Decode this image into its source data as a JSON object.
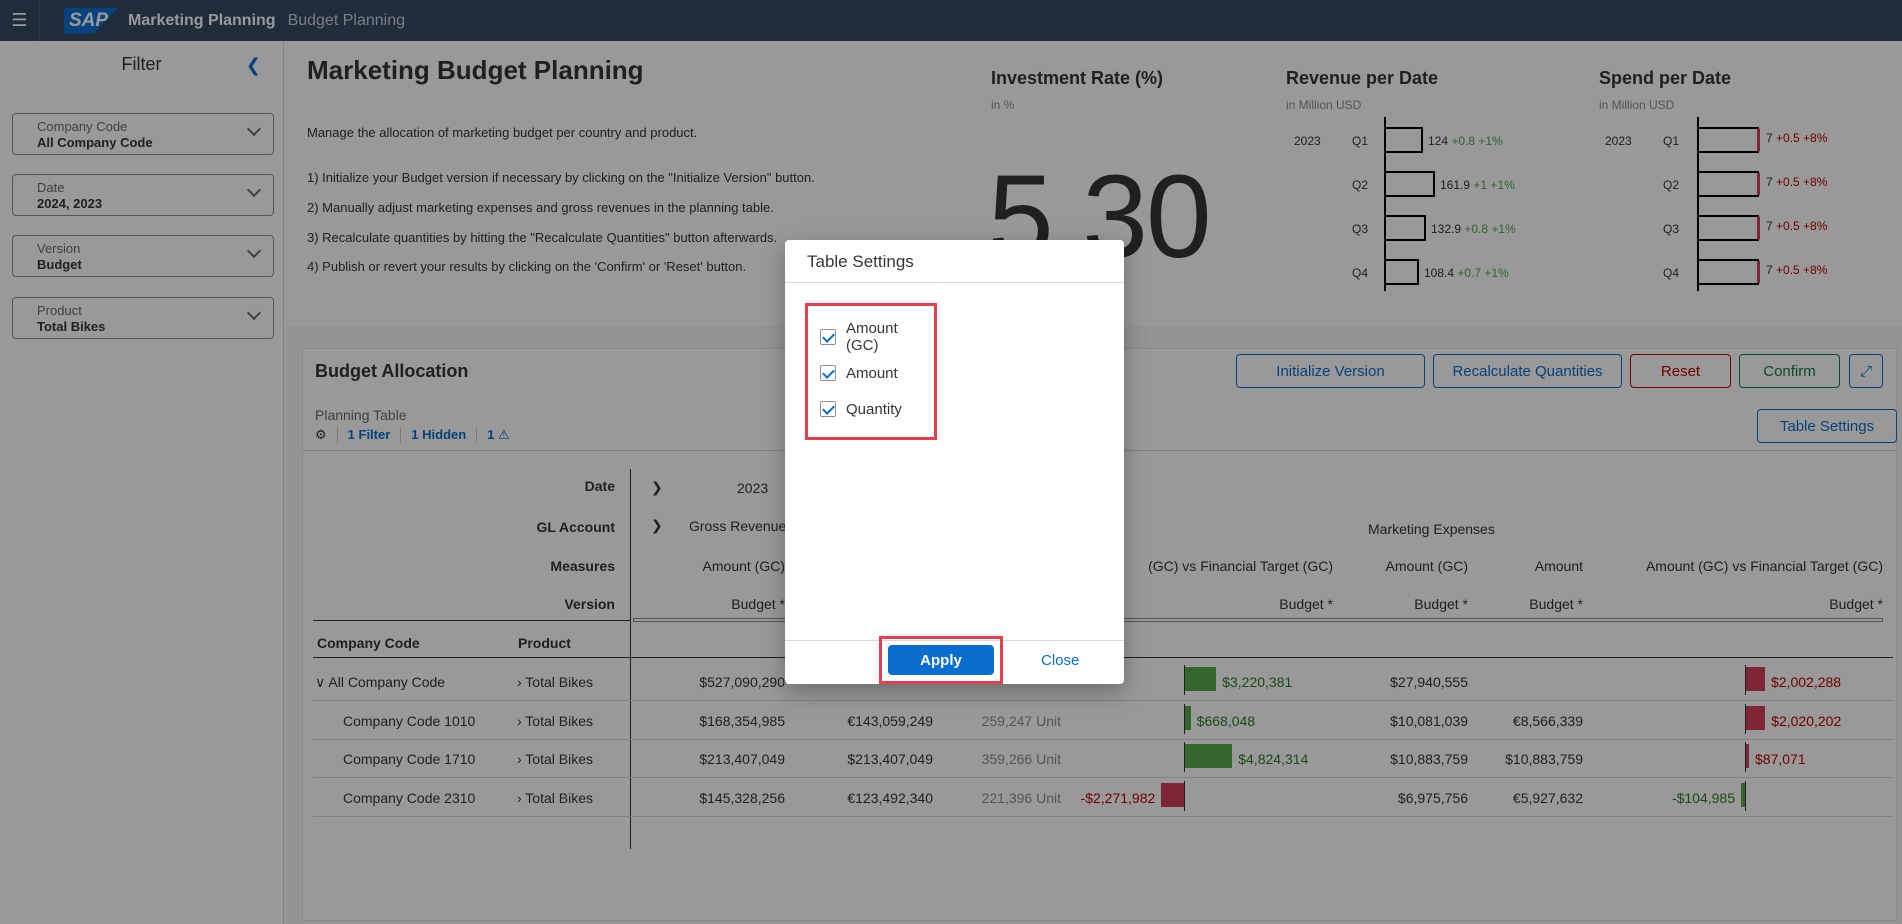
{
  "shell": {
    "logo": "SAP",
    "app_title": "Marketing Planning",
    "app_subtitle": "Budget Planning"
  },
  "filter": {
    "title": "Filter",
    "fields": [
      {
        "label": "Company Code",
        "value": "All Company Code"
      },
      {
        "label": "Date",
        "value": "2024, 2023"
      },
      {
        "label": "Version",
        "value": "Budget"
      },
      {
        "label": "Product",
        "value": "Total Bikes"
      }
    ]
  },
  "intro": {
    "title": "Marketing Budget Planning",
    "description": "Manage the allocation of marketing budget per country and product.",
    "steps": [
      "1) Initialize your Budget version if necessary by clicking on the \"Initialize Version\" button.",
      "2) Manually adjust marketing expenses and gross revenues in the planning table.",
      "3) Recalculate quantities by hitting the \"Recalculate Quantities\" button afterwards.",
      "4) Publish or revert your results by clicking on the 'Confirm' or 'Reset' button."
    ]
  },
  "kpis": {
    "investment": {
      "title": "Investment Rate (%)",
      "sub": "in %",
      "value": "5.30"
    },
    "revenue": {
      "title": "Revenue per Date",
      "sub": "in Million USD",
      "year": "2023",
      "rows": [
        {
          "q": "Q1",
          "value": "124",
          "delta": "+0.8",
          "pct": "+1%"
        },
        {
          "q": "Q2",
          "value": "161.9",
          "delta": "+1",
          "pct": "+1%"
        },
        {
          "q": "Q3",
          "value": "132.9",
          "delta": "+0.8",
          "pct": "+1%"
        },
        {
          "q": "Q4",
          "value": "108.4",
          "delta": "+0.7",
          "pct": "+1%"
        }
      ]
    },
    "spend": {
      "title": "Spend per Date",
      "sub": "in Million USD",
      "year": "2023",
      "rows": [
        {
          "q": "Q1",
          "value": "7",
          "delta": "+0.5",
          "pct": "+8%"
        },
        {
          "q": "Q2",
          "value": "7",
          "delta": "+0.5",
          "pct": "+8%"
        },
        {
          "q": "Q3",
          "value": "7",
          "delta": "+0.5",
          "pct": "+8%"
        },
        {
          "q": "Q4",
          "value": "7",
          "delta": "+0.5",
          "pct": "+8%"
        }
      ]
    }
  },
  "budget": {
    "title": "Budget Allocation",
    "buttons": {
      "initialize": "Initialize Version",
      "recalc": "Recalculate Quantities",
      "reset": "Reset",
      "confirm": "Confirm",
      "table_settings": "Table Settings"
    },
    "planning_table": "Planning Table",
    "tools": {
      "filter": "1 Filter",
      "hidden": "1 Hidden",
      "warnings": "1"
    },
    "headers": {
      "date": "Date",
      "gl_account": "GL Account",
      "measures": "Measures",
      "version": "Version",
      "year": "2023",
      "gross_revenue": "Gross Revenue",
      "marketing_expenses": "Marketing Expenses",
      "amount_gc": "Amount (GC)",
      "amount": "Amount",
      "vs_target_partial": "(GC) vs Financial Target (GC)",
      "vs_target": "Amount (GC) vs Financial Target (GC)",
      "budget": "Budget *",
      "company_code": "Company Code",
      "product": "Product"
    },
    "rows": [
      {
        "company": "All Company Code",
        "product": "Total Bikes",
        "rev_gc": "$527,090,290",
        "rev_amt": "",
        "qty": "",
        "var1": "$3,220,381",
        "exp_gc": "$27,940,555",
        "exp_amt": "",
        "var2": "$2,002,288"
      },
      {
        "company": "Company Code 1010",
        "product": "Total Bikes",
        "rev_gc": "$168,354,985",
        "rev_amt": "€143,059,249",
        "qty": "259,247 Unit",
        "var1": "$668,048",
        "exp_gc": "$10,081,039",
        "exp_amt": "€8,566,339",
        "var2": "$2,020,202"
      },
      {
        "company": "Company Code 1710",
        "product": "Total Bikes",
        "rev_gc": "$213,407,049",
        "rev_amt": "$213,407,049",
        "qty": "359,266 Unit",
        "var1": "$4,824,314",
        "exp_gc": "$10,883,759",
        "exp_amt": "$10,883,759",
        "var2": "$87,071"
      },
      {
        "company": "Company Code 2310",
        "product": "Total Bikes",
        "rev_gc": "$145,328,256",
        "rev_amt": "€123,492,340",
        "qty": "221,396 Unit",
        "var1": "-$2,271,982",
        "exp_gc": "$6,975,756",
        "exp_amt": "€5,927,632",
        "var2": "-$104,985"
      }
    ]
  },
  "dialog": {
    "title": "Table Settings",
    "options": [
      {
        "label": "Amount (GC)"
      },
      {
        "label": "Amount"
      },
      {
        "label": "Quantity"
      }
    ],
    "apply": "Apply",
    "close": "Close"
  },
  "icons": {
    "menu": "menu-icon",
    "collapse": "chevron-left-icon",
    "fullscreen": "fullscreen-icon",
    "settings": "settings-icon",
    "warning": "warning-icon"
  }
}
